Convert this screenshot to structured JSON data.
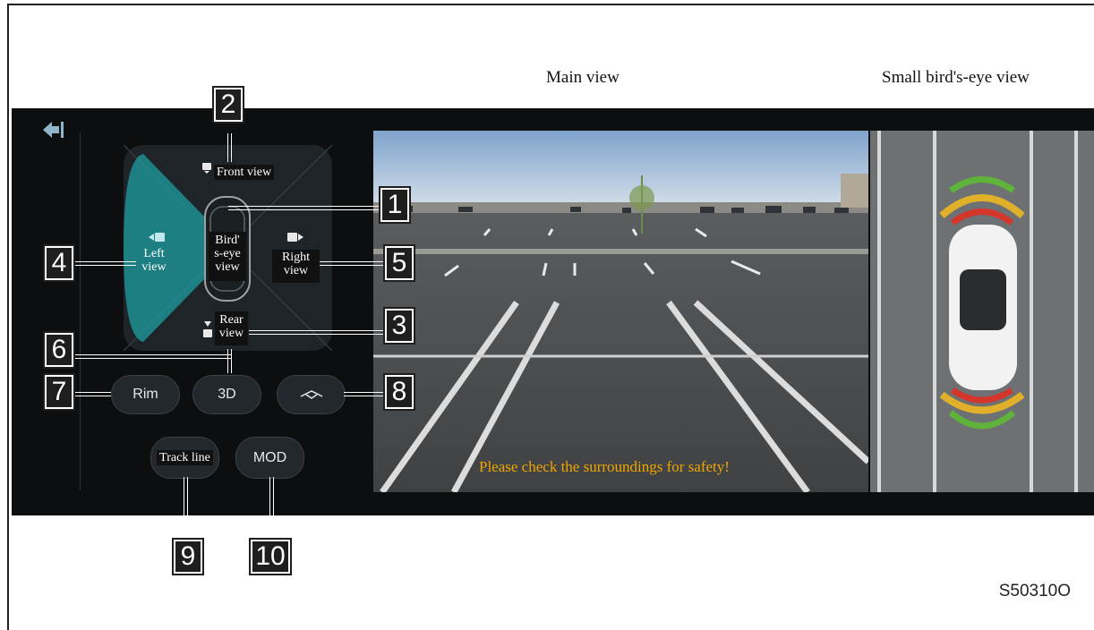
{
  "labels": {
    "main_view": "Main view",
    "small_birdseye_view": "Small bird's-eye view"
  },
  "controls": {
    "front_view": "Front view",
    "rear_view_line1": "Rear",
    "rear_view_line2": "view",
    "left_view_line1": "Left",
    "left_view_line2": "view",
    "right_view_line1": "Right",
    "right_view_line2": "view",
    "birdseye_line1": "Bird'",
    "birdseye_line2": "s-eye",
    "birdseye_line3": "view",
    "rim_button": "Rim",
    "3d_button": "3D",
    "track_line_button": "Track line",
    "mod_button": "MOD"
  },
  "callouts": [
    "1",
    "2",
    "3",
    "4",
    "5",
    "6",
    "7",
    "8",
    "9",
    "10"
  ],
  "warning": "Please check the surroundings for safety!",
  "figure_code": "S50310O",
  "icons": {
    "back": "back-icon",
    "front_camera": "camera-icon",
    "rear_camera": "camera-icon",
    "left_camera": "camera-icon",
    "right_camera": "camera-icon",
    "view_angle": "view-angle-icon"
  },
  "colors": {
    "left_view_active": "#1f8f94",
    "warning_text": "#f0a500",
    "sensor_green": "#5fb33a",
    "sensor_yellow": "#e0b02a",
    "sensor_red": "#d4362c"
  }
}
